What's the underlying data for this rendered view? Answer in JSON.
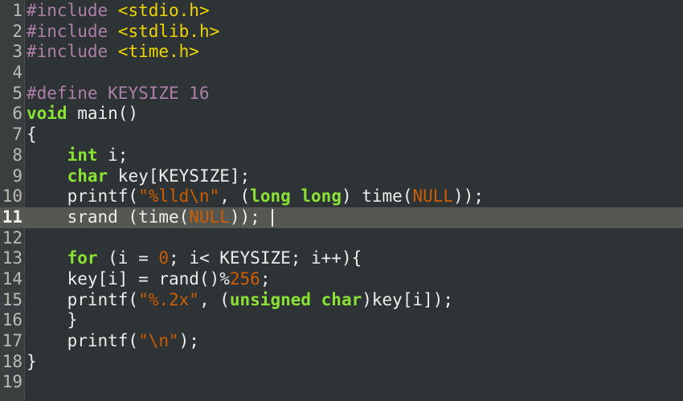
{
  "editor": {
    "current_line": 11,
    "lines": [
      {
        "n": "1",
        "tokens": [
          {
            "t": "#include ",
            "c": "pp"
          },
          {
            "t": "<stdio.h>",
            "c": "str"
          }
        ]
      },
      {
        "n": "2",
        "tokens": [
          {
            "t": "#include ",
            "c": "pp"
          },
          {
            "t": "<stdlib.h>",
            "c": "str"
          }
        ]
      },
      {
        "n": "3",
        "tokens": [
          {
            "t": "#include ",
            "c": "pp"
          },
          {
            "t": "<time.h>",
            "c": "str"
          }
        ]
      },
      {
        "n": "4",
        "tokens": []
      },
      {
        "n": "5",
        "tokens": [
          {
            "t": "#define KEYSIZE 16",
            "c": "pp"
          }
        ]
      },
      {
        "n": "6",
        "tokens": [
          {
            "t": "void",
            "c": "kw"
          },
          {
            "t": " main()",
            "c": "plain"
          }
        ]
      },
      {
        "n": "7",
        "tokens": [
          {
            "t": "{",
            "c": "plain"
          }
        ]
      },
      {
        "n": "8",
        "tokens": [
          {
            "t": "    ",
            "c": "plain"
          },
          {
            "t": "int",
            "c": "kw"
          },
          {
            "t": " i;",
            "c": "plain"
          }
        ]
      },
      {
        "n": "9",
        "tokens": [
          {
            "t": "    ",
            "c": "plain"
          },
          {
            "t": "char",
            "c": "kw"
          },
          {
            "t": " key[KEYSIZE];",
            "c": "plain"
          }
        ]
      },
      {
        "n": "10",
        "tokens": [
          {
            "t": "    printf(",
            "c": "plain"
          },
          {
            "t": "\"%lld\\n\"",
            "c": "num"
          },
          {
            "t": ", (",
            "c": "plain"
          },
          {
            "t": "long long",
            "c": "kw"
          },
          {
            "t": ") time(",
            "c": "plain"
          },
          {
            "t": "NULL",
            "c": "num"
          },
          {
            "t": "));",
            "c": "plain"
          }
        ]
      },
      {
        "n": "11",
        "tokens": [
          {
            "t": "    srand (time(",
            "c": "plain"
          },
          {
            "t": "NULL",
            "c": "num"
          },
          {
            "t": ")); ",
            "c": "plain"
          }
        ],
        "cursor": true
      },
      {
        "n": "12",
        "tokens": []
      },
      {
        "n": "13",
        "tokens": [
          {
            "t": "    ",
            "c": "plain"
          },
          {
            "t": "for",
            "c": "kw"
          },
          {
            "t": " (i = ",
            "c": "plain"
          },
          {
            "t": "0",
            "c": "num"
          },
          {
            "t": "; i< KEYSIZE; i++){",
            "c": "plain"
          }
        ]
      },
      {
        "n": "14",
        "tokens": [
          {
            "t": "    key[i] = rand()%",
            "c": "plain"
          },
          {
            "t": "256",
            "c": "num"
          },
          {
            "t": ";",
            "c": "plain"
          }
        ]
      },
      {
        "n": "15",
        "tokens": [
          {
            "t": "    printf(",
            "c": "plain"
          },
          {
            "t": "\"%.2x\"",
            "c": "num"
          },
          {
            "t": ", (",
            "c": "plain"
          },
          {
            "t": "unsigned char",
            "c": "kw"
          },
          {
            "t": ")key[i]);",
            "c": "plain"
          }
        ]
      },
      {
        "n": "16",
        "tokens": [
          {
            "t": "    }",
            "c": "plain"
          }
        ]
      },
      {
        "n": "17",
        "tokens": [
          {
            "t": "    printf(",
            "c": "plain"
          },
          {
            "t": "\"\\n\"",
            "c": "num"
          },
          {
            "t": ");",
            "c": "plain"
          }
        ]
      },
      {
        "n": "18",
        "tokens": [
          {
            "t": "}",
            "c": "plain"
          }
        ]
      },
      {
        "n": "19",
        "tokens": []
      }
    ]
  },
  "colors": {
    "background": "#2e3436",
    "gutter": "#3b3e3f",
    "current_line": "#555753",
    "preprocessor": "#ad7fa8",
    "string": "#edd400",
    "keyword": "#8ae234",
    "constant": "#ce5c00",
    "text": "#eeeeec"
  }
}
